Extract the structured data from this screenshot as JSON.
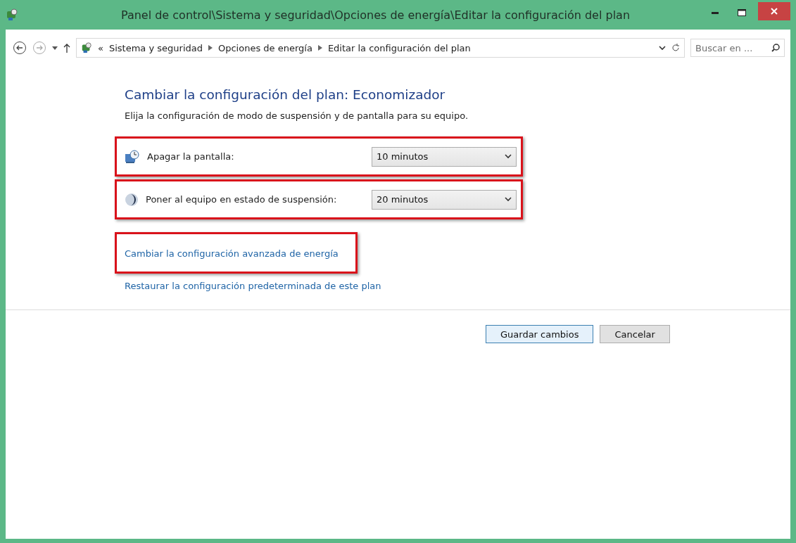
{
  "window": {
    "title": "Panel de control\\Sistema y seguridad\\Opciones de energía\\Editar la configuración del plan"
  },
  "address_bar": {
    "overflow": "«",
    "crumbs": [
      "Sistema y seguridad",
      "Opciones de energía",
      "Editar la configuración del plan"
    ]
  },
  "search": {
    "placeholder": "Buscar en ..."
  },
  "heading": "Cambiar la configuración del plan: Economizador",
  "subtitle": "Elija la configuración de modo de suspensión y de pantalla para su equipo.",
  "settings": [
    {
      "kind": "display",
      "label": "Apagar la pantalla:",
      "value": "10 minutos",
      "highlighted": true
    },
    {
      "kind": "sleep",
      "label": "Poner al equipo en estado de suspensión:",
      "value": "20 minutos",
      "highlighted": true
    }
  ],
  "links": [
    {
      "text": "Cambiar la configuración avanzada de energía",
      "highlighted": true
    },
    {
      "text": "Restaurar la configuración predeterminada de este plan",
      "highlighted": false
    }
  ],
  "buttons": [
    {
      "label": "Guardar cambios",
      "default": true
    },
    {
      "label": "Cancelar",
      "default": false
    }
  ]
}
